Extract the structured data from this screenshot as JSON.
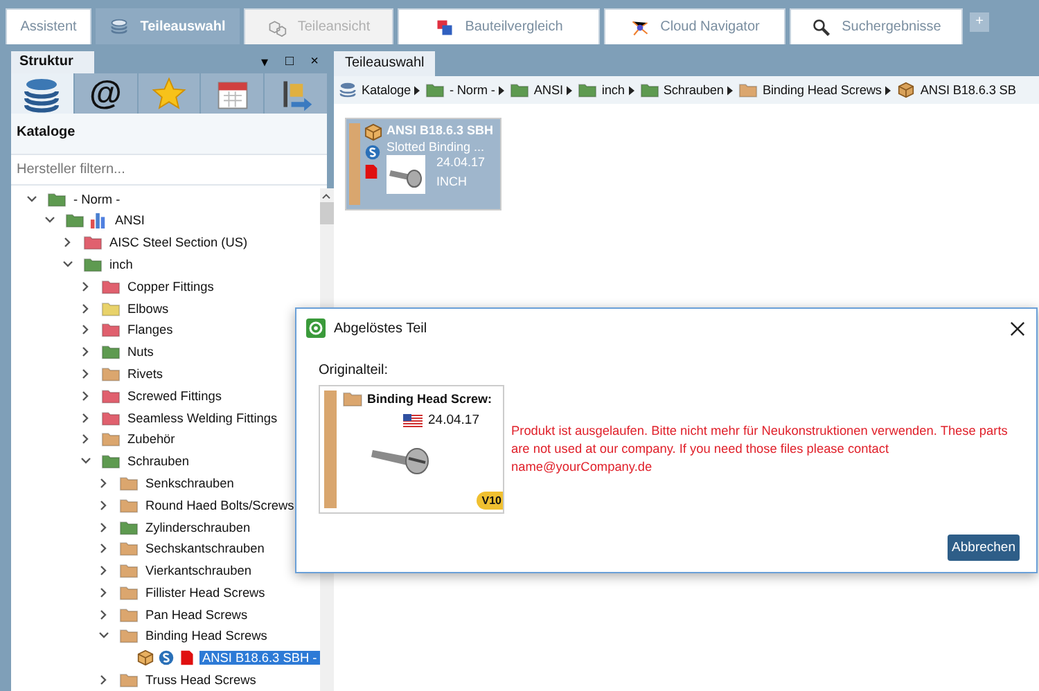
{
  "tabs": [
    {
      "label": "Assistent",
      "selected": false,
      "disabled": false
    },
    {
      "label": "Teileauswahl",
      "selected": true,
      "disabled": false
    },
    {
      "label": "Teileansicht",
      "selected": false,
      "disabled": true
    },
    {
      "label": "Bauteilvergleich",
      "selected": false,
      "disabled": false
    },
    {
      "label": "Cloud Navigator",
      "selected": false,
      "disabled": false
    },
    {
      "label": "Suchergebnisse",
      "selected": false,
      "disabled": false
    }
  ],
  "add_tab": "+",
  "left_panel": {
    "tab": "Struktur",
    "controls": [
      "▾",
      "□",
      "×"
    ],
    "tool_tabs": [
      {
        "selected": true
      },
      {
        "label": "@",
        "selected": false
      },
      {
        "selected": false
      },
      {
        "selected": false
      },
      {
        "selected": false
      }
    ],
    "heading": "Kataloge",
    "filter": {
      "placeholder": "Hersteller filtern..."
    },
    "tree": [
      {
        "label": "- Norm -",
        "kind": "folder",
        "color": "#5e9a50",
        "expanded": true,
        "children": [
          {
            "label": "ANSI",
            "kind": "folder-chart",
            "color": "#5e9a50",
            "expanded": true,
            "children": [
              {
                "label": "AISC Steel Section (US)",
                "kind": "folder",
                "color": "#e0606e",
                "expanded": false
              },
              {
                "label": "inch",
                "kind": "folder",
                "color": "#5e9a50",
                "expanded": true,
                "children": [
                  {
                    "label": "Copper Fittings",
                    "kind": "folder",
                    "color": "#e0606e",
                    "expanded": false
                  },
                  {
                    "label": "Elbows",
                    "kind": "folder",
                    "color": "#e8d26a",
                    "expanded": false
                  },
                  {
                    "label": "Flanges",
                    "kind": "folder",
                    "color": "#e0606e",
                    "expanded": false
                  },
                  {
                    "label": "Nuts",
                    "kind": "folder",
                    "color": "#5e9a50",
                    "expanded": false
                  },
                  {
                    "label": "Rivets",
                    "kind": "folder",
                    "color": "#dba66e",
                    "expanded": false
                  },
                  {
                    "label": "Screwed Fittings",
                    "kind": "folder",
                    "color": "#e0606e",
                    "expanded": false
                  },
                  {
                    "label": "Seamless Welding Fittings",
                    "kind": "folder",
                    "color": "#e0606e",
                    "expanded": false
                  },
                  {
                    "label": "Zubehör",
                    "kind": "folder",
                    "color": "#dba66e",
                    "expanded": false
                  },
                  {
                    "label": "Schrauben",
                    "kind": "folder",
                    "color": "#5e9a50",
                    "expanded": true,
                    "children": [
                      {
                        "label": "Senkschrauben",
                        "kind": "folder",
                        "color": "#dba66e",
                        "expanded": false
                      },
                      {
                        "label": "Round Haed Bolts/Screws",
                        "kind": "folder",
                        "color": "#dba66e",
                        "expanded": false
                      },
                      {
                        "label": "Zylinderschrauben",
                        "kind": "folder",
                        "color": "#5e9a50",
                        "expanded": false
                      },
                      {
                        "label": "Sechskantschrauben",
                        "kind": "folder",
                        "color": "#dba66e",
                        "expanded": false
                      },
                      {
                        "label": "Vierkantschrauben",
                        "kind": "folder",
                        "color": "#dba66e",
                        "expanded": false
                      },
                      {
                        "label": "Fillister Head Screws",
                        "kind": "folder",
                        "color": "#dba66e",
                        "expanded": false
                      },
                      {
                        "label": "Pan Head Screws",
                        "kind": "folder",
                        "color": "#dba66e",
                        "expanded": false
                      },
                      {
                        "label": "Binding Head Screws",
                        "kind": "folder",
                        "color": "#dba66e",
                        "expanded": true,
                        "children": [
                          {
                            "label": "ANSI B18.6.3 SBH -",
                            "kind": "part",
                            "selected": true
                          }
                        ]
                      },
                      {
                        "label": "Truss Head Screws",
                        "kind": "folder",
                        "color": "#dba66e",
                        "expanded": false
                      }
                    ]
                  }
                ]
              }
            ]
          }
        ]
      }
    ]
  },
  "main": {
    "tab": "Teileauswahl",
    "breadcrumb": [
      {
        "label": "Kataloge",
        "kind": "catalog",
        "color": "#5e7fa8"
      },
      {
        "label": "- Norm -",
        "kind": "folder",
        "color": "#5e9a50"
      },
      {
        "label": "ANSI",
        "kind": "folder",
        "color": "#5e9a50"
      },
      {
        "label": "inch",
        "kind": "folder",
        "color": "#5e9a50"
      },
      {
        "label": "Schrauben",
        "kind": "folder",
        "color": "#5e9a50"
      },
      {
        "label": "Binding Head Screws",
        "kind": "folder",
        "color": "#dba66e"
      },
      {
        "label": "ANSI B18.6.3 SB",
        "kind": "part",
        "color": "#d9a25a"
      }
    ],
    "card": {
      "title": "ANSI B18.6.3 SBH",
      "subtitle": "Slotted Binding ...",
      "date": "24.04.17",
      "unit": "INCH",
      "selected": true
    }
  },
  "dialog": {
    "title": "Abgelöstes Teil",
    "label": "Originalteil:",
    "card": {
      "title": "Binding Head Screw:",
      "date": "24.04.17",
      "badge": "V10"
    },
    "message": "Produkt ist ausgelaufen. Bitte nicht mehr für Neukonstruktionen verwenden. These parts are not used at our company. If you need those files please contact name@yourCompany.de",
    "button": "Abbrechen"
  }
}
